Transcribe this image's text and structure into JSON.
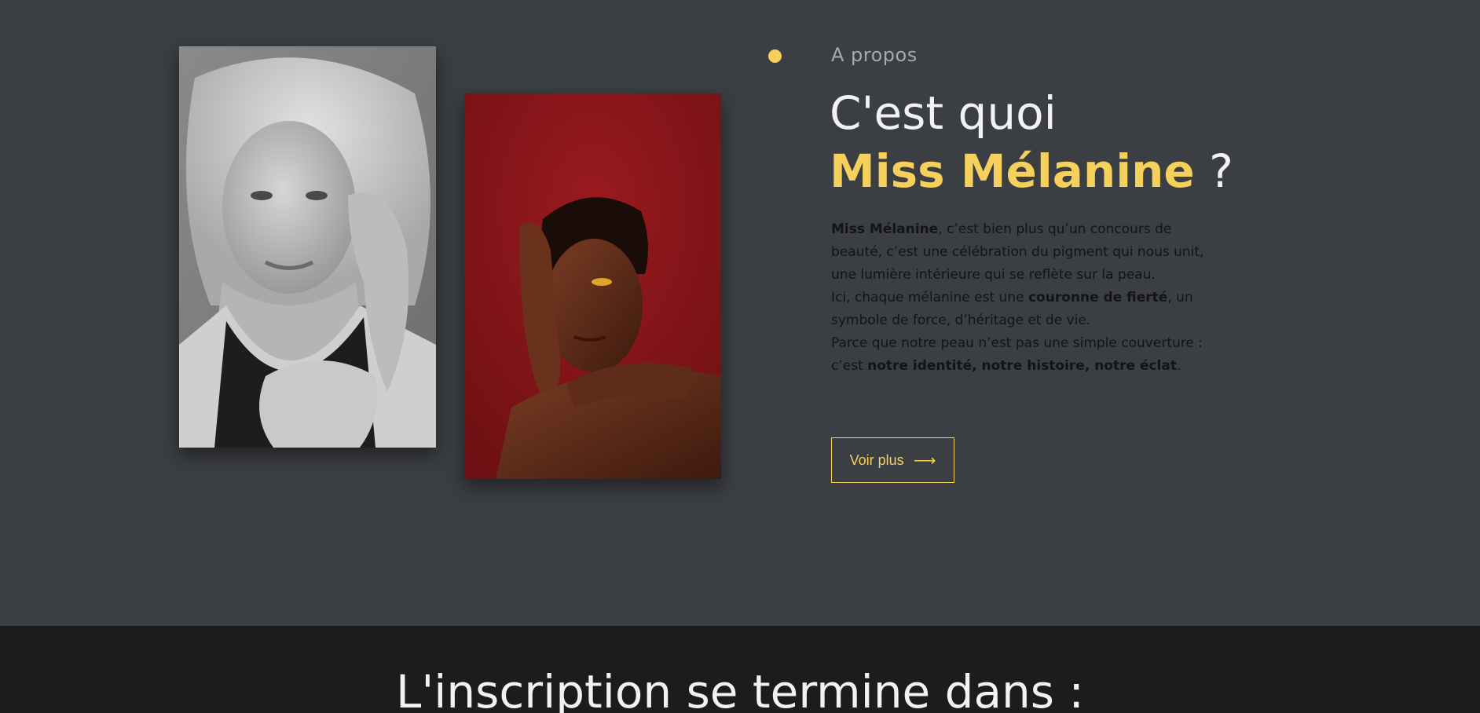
{
  "about": {
    "eyebrow": "A propos",
    "title_line1": "C'est quoi",
    "title_accent": "Miss Mélanine",
    "title_suffix": " ?",
    "paragraphs": {
      "p1_bold": "Miss Mélanine",
      "p1_rest": ", c’est bien plus qu’un concours de beauté, c’est une célébration du pigment qui nous unit, une lumière intérieure qui se reflète sur la peau.",
      "p2_start": "Ici, chaque mélanine est une ",
      "p2_bold": "couronne de fierté",
      "p2_rest": ", un symbole de force, d’héritage et de vie.",
      "p3_start": "Parce que notre peau n’est pas une simple couverture : c’est ",
      "p3_bold": "notre identité, notre histoire, notre éclat",
      "p3_end": "."
    },
    "button_label": "Voir plus",
    "button_icon": "long-arrow-right-icon",
    "accent_color": "#f5d05c"
  },
  "countdown": {
    "title": "L'inscription se termine dans :"
  }
}
